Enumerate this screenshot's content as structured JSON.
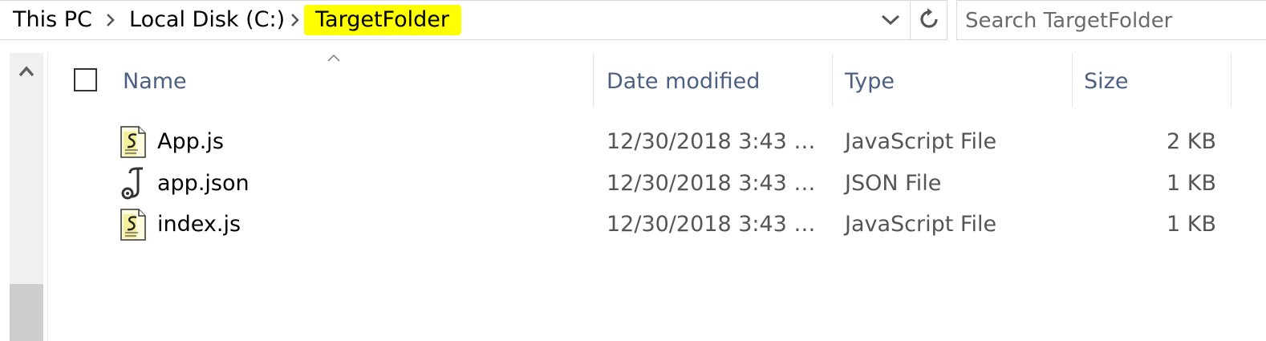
{
  "breadcrumb": {
    "items": [
      "This PC",
      "Local Disk (C:)",
      "TargetFolder"
    ]
  },
  "search": {
    "placeholder": "Search TargetFolder"
  },
  "columns": {
    "name": "Name",
    "date": "Date modified",
    "type": "Type",
    "size": "Size"
  },
  "files": [
    {
      "name": "App.js",
      "date": "12/30/2018 3:43 AM",
      "type": "JavaScript File",
      "size": "2 KB",
      "icon": "javascript-file-icon"
    },
    {
      "name": "app.json",
      "date": "12/30/2018 3:43 AM",
      "type": "JSON File",
      "size": "1 KB",
      "icon": "json-file-icon"
    },
    {
      "name": "index.js",
      "date": "12/30/2018 3:43 AM",
      "type": "JavaScript File",
      "size": "1 KB",
      "icon": "javascript-file-icon"
    }
  ],
  "colors": {
    "highlight": "#ffff00",
    "header_text": "#4d6082"
  }
}
